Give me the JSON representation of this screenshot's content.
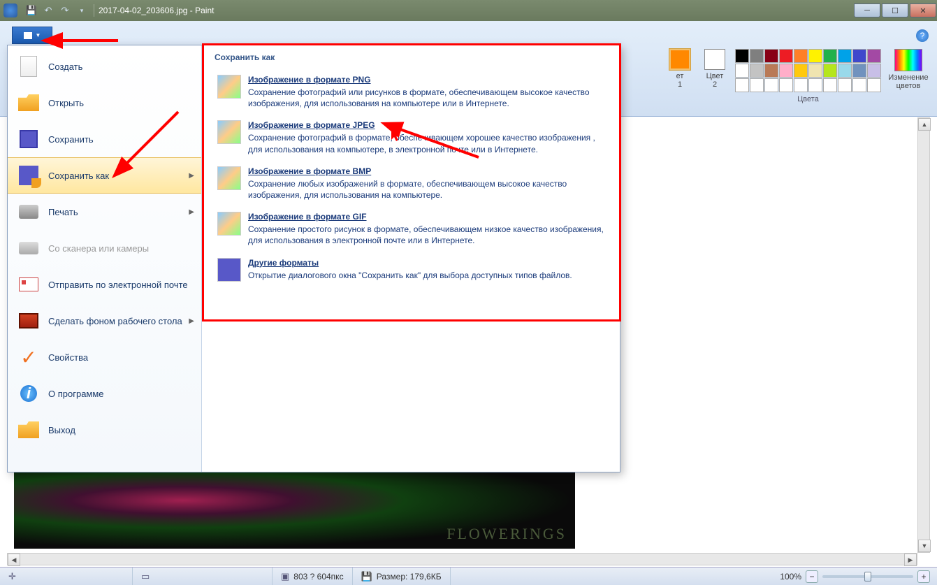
{
  "title": "2017-04-02_203606.jpg - Paint",
  "ribbon": {
    "color1_label": "ет\n1",
    "color2_label": "Цвет\n2",
    "colors_label": "Цвета",
    "edit_colors_label": "Изменение\nцветов",
    "palette": [
      [
        "#000000",
        "#7f7f7f",
        "#880015",
        "#ed1c24",
        "#ff7f27",
        "#fff200",
        "#22b14c",
        "#00a2e8",
        "#3f48cc",
        "#a349a4"
      ],
      [
        "#ffffff",
        "#c3c3c3",
        "#b97a57",
        "#ffaec9",
        "#ffc90e",
        "#efe4b0",
        "#b5e61d",
        "#99d9ea",
        "#7092be",
        "#c8bfe7"
      ],
      [
        "#ffffff",
        "#ffffff",
        "#ffffff",
        "#ffffff",
        "#ffffff",
        "#ffffff",
        "#ffffff",
        "#ffffff",
        "#ffffff",
        "#ffffff"
      ]
    ]
  },
  "menu": {
    "items": [
      {
        "label": "Создать",
        "icon": "new"
      },
      {
        "label": "Открыть",
        "icon": "open"
      },
      {
        "label": "Сохранить",
        "icon": "save"
      },
      {
        "label": "Сохранить как",
        "icon": "saveas",
        "arrow": true,
        "selected": true
      },
      {
        "label": "Печать",
        "icon": "print",
        "arrow": true
      },
      {
        "label": "Со сканера или камеры",
        "icon": "scanner",
        "disabled": true
      },
      {
        "label": "Отправить по электронной почте",
        "icon": "email"
      },
      {
        "label": "Сделать фоном рабочего стола",
        "icon": "desktop",
        "arrow": true
      },
      {
        "label": "Свойства",
        "icon": "props"
      },
      {
        "label": "О программе",
        "icon": "about"
      },
      {
        "label": "Выход",
        "icon": "exit"
      }
    ],
    "submenu_title": "Сохранить как",
    "submenu": [
      {
        "title": "Изображение в формате PNG",
        "desc": "Сохранение фотографий или рисунков в формате, обеспечивающем высокое качество изображения, для использования на компьютере или в Интернете."
      },
      {
        "title": "Изображение в формате JPEG",
        "desc": "Сохранение фотографий в формате, обеспечивающем хорошее качество изображения , для использования на компьютере, в электронной почте или в Интернете."
      },
      {
        "title": "Изображение в формате BMP",
        "desc": "Сохранение любых изображений в формате, обеспечивающем высокое качество изображения, для использования на компьютере."
      },
      {
        "title": "Изображение в формате GIF",
        "desc": "Сохранение простого рисунок в формате, обеспечивающем низкое качество изображения, для использования в электронной почте или в Интернете."
      },
      {
        "title": "Другие форматы",
        "desc": "Открытие диалогового окна \"Сохранить как\" для выбора доступных типов файлов."
      }
    ]
  },
  "canvas": {
    "brand": "FLOWERINGS"
  },
  "status": {
    "dimensions": "803 ? 604пкс",
    "size_label": "Размер: 179,6КБ",
    "zoom": "100%"
  }
}
